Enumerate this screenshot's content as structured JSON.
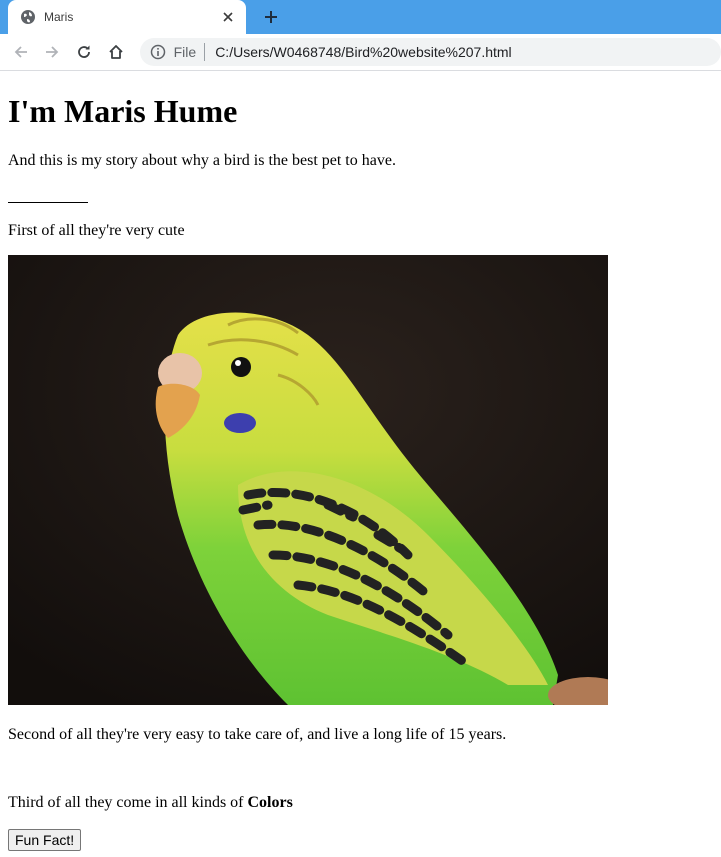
{
  "browser": {
    "tab_title": "Maris",
    "address_prefix": "File",
    "url": "C:/Users/W0468748/Bird%20website%207.html",
    "tabbar_color": "#4a9fe8"
  },
  "page": {
    "heading": "I'm Maris Hume",
    "intro": "And this is my story about why a bird is the best pet to have.",
    "first_point": "First of all they're very cute",
    "photo_icon": "budgie-photo",
    "second_point": "Second of all they're very easy to take care of, and live a long life of 15 years.",
    "third_point_prefix": "Third of all they come in all kinds of ",
    "third_point_bold": "Colors",
    "button_label": "Fun Fact!"
  }
}
